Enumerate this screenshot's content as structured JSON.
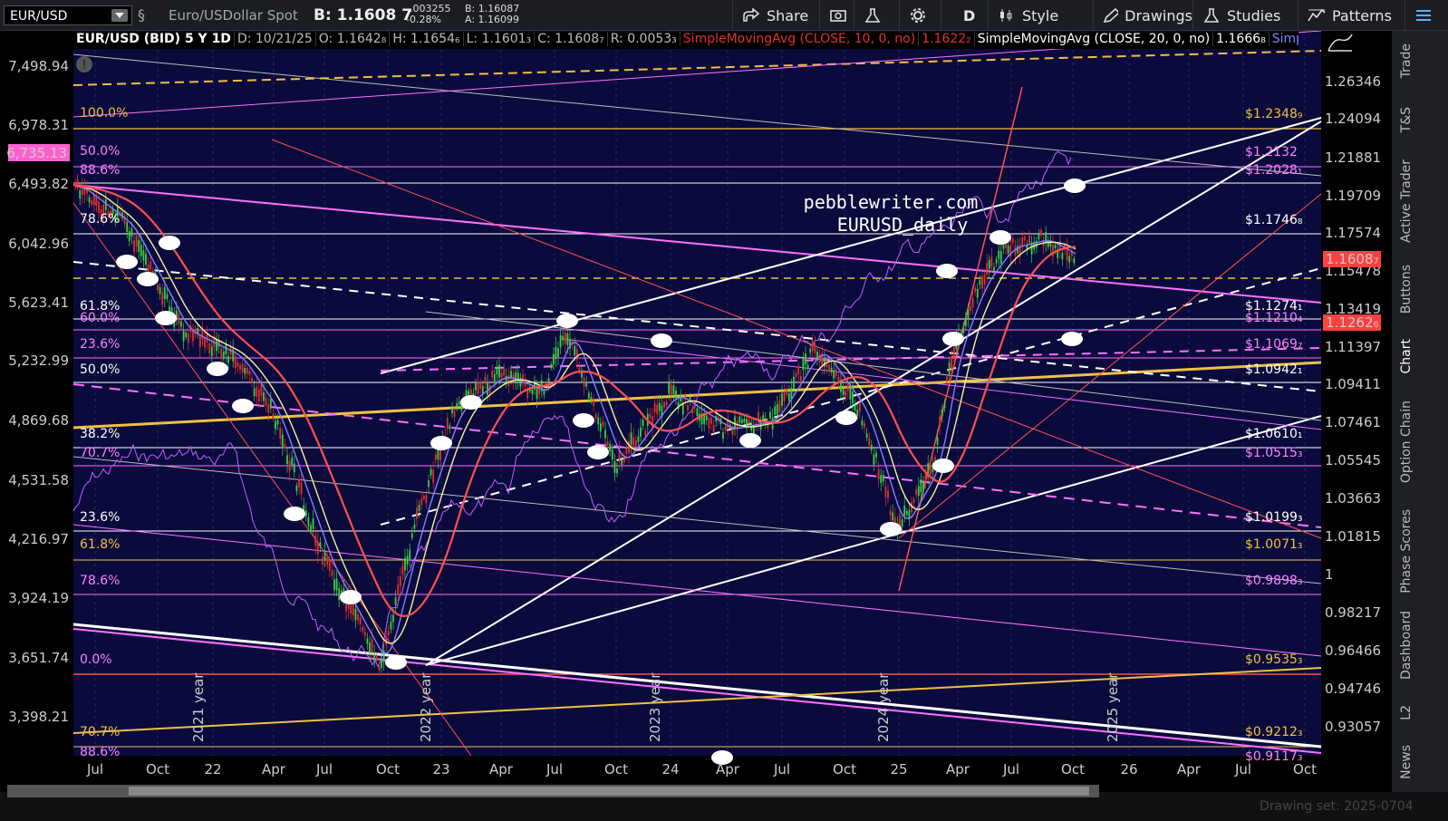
{
  "toolbar": {
    "symbol": "EUR/USD",
    "description": "Euro/USDollar Spot",
    "bid_price": "B: 1.1608 7",
    "net_change": "-.003255",
    "pct_change": "-0.28%",
    "bid_small": "B: 1.16087",
    "ask_small": "A: 1.16099",
    "buttons": [
      "Share",
      "D",
      "Style",
      "Drawings",
      "Studies",
      "Patterns"
    ]
  },
  "chart_header": {
    "symbol": "EUR/USD (BID) 5 Y 1D",
    "date": "D: 10/21/25",
    "open": "O: 1.1642₈",
    "high": "H: 1.1654₆",
    "low": "L: 1.1601₃",
    "close": "C: 1.1608₇",
    "range": "R: 0.0053₃",
    "sma10_label": "SimpleMovingAvg (CLOSE, 10, 0, no)",
    "sma10_value": "1.1622₂",
    "sma20_label": "SimpleMovingAvg (CLOSE, 20, 0, no)",
    "sma20_value": "1.1666₈",
    "more": "Simple..."
  },
  "watermark": {
    "line1": "pebblewriter.com",
    "line2": "EURUSD_daily"
  },
  "left_axis": [
    "7,498.94",
    "6,978.31",
    "6,493.82",
    "6,042.96",
    "5,623.41",
    "5,232.99",
    "4,869.68",
    "4,531.58",
    "4,216.97",
    "3,924.19",
    "3,651.74",
    "3,398.21"
  ],
  "left_axis_highlight": "6,735.13",
  "right_axis": [
    "1.26346",
    "1.24094",
    "1.21881",
    "1.19709",
    "1.17574",
    "1.15478",
    "1.13419",
    "1.11397",
    "1.09411",
    "1.07461",
    "1.05545",
    "1.03663",
    "1.01815",
    "1",
    "0.98217",
    "0.96466",
    "0.94746",
    "0.93057"
  ],
  "price_marker": "1.1608₇",
  "sma_marker": "1.1262₆",
  "x_axis": [
    "Jul",
    "Oct",
    "22",
    "Apr",
    "Jul",
    "Oct",
    "23",
    "Apr",
    "Jul",
    "Oct",
    "24",
    "Apr",
    "Jul",
    "Oct",
    "25",
    "Apr",
    "Jul",
    "Oct",
    "26",
    "Apr",
    "Jul",
    "Oct"
  ],
  "year_labels": [
    "2021 year",
    "2022 year",
    "2023 year",
    "2024 year",
    "2025 year"
  ],
  "fib_left": [
    {
      "label": "100.0%",
      "color": "#f0c040"
    },
    {
      "label": "50.0%",
      "color": "#ff80ff"
    },
    {
      "label": "88.6%",
      "color": "#ff80ff"
    },
    {
      "label": "78.6%",
      "color": "#ffffff"
    },
    {
      "label": "61.8%",
      "color": "#ffffff"
    },
    {
      "label": "60.0%",
      "color": "#ff80ff"
    },
    {
      "label": "23.6%",
      "color": "#ff80ff"
    },
    {
      "label": "50.0%",
      "color": "#ffffff"
    },
    {
      "label": "38.2%",
      "color": "#ffffff"
    },
    {
      "label": "70.7%",
      "color": "#ff80ff"
    },
    {
      "label": "23.6%",
      "color": "#ffffff"
    },
    {
      "label": "61.8%",
      "color": "#f0c040"
    },
    {
      "label": "78.6%",
      "color": "#ff80ff"
    },
    {
      "label": "0.0%",
      "color": "#ff80ff"
    },
    {
      "label": "70.7%",
      "color": "#f0c040"
    },
    {
      "label": "88.6%",
      "color": "#ff80ff"
    }
  ],
  "fib_right": [
    {
      "label": "$1.2348₉",
      "color": "#f0c040"
    },
    {
      "label": "$1.2132",
      "color": "#ff80ff"
    },
    {
      "label": "$1.2028₁",
      "color": "#ff80ff"
    },
    {
      "label": "$1.1746₈",
      "color": "#ffffff"
    },
    {
      "label": "$1.1274₁",
      "color": "#ffffff"
    },
    {
      "label": "$1.1210₄",
      "color": "#ff80ff"
    },
    {
      "label": "$1.1069₇",
      "color": "#ff80ff"
    },
    {
      "label": "$1.0942₁",
      "color": "#ffffff"
    },
    {
      "label": "$1.0610₁",
      "color": "#ffffff"
    },
    {
      "label": "$1.0515₃",
      "color": "#ff80ff"
    },
    {
      "label": "$1.0199₃",
      "color": "#ffffff"
    },
    {
      "label": "$1.0071₃",
      "color": "#f0c040"
    },
    {
      "label": "$0.9898₃",
      "color": "#ff80ff"
    },
    {
      "label": "$0.9535₃",
      "color": "#f0c040"
    },
    {
      "label": "$0.9212₃",
      "color": "#f0c040"
    },
    {
      "label": "$0.9117₃",
      "color": "#ff80ff"
    }
  ],
  "side_tabs": [
    "Trade",
    "T&S",
    "Active Trader",
    "Buttons",
    "Chart",
    "Option Chain",
    "Phase Scores",
    "Dashboard",
    "L2",
    "News"
  ],
  "drawing_set": "Drawing set: 2025-0704",
  "colors": {
    "chart_bg": "#0a0a3c",
    "pink": "#ff70ff",
    "gold": "#f0c040",
    "red_ma": "#ff5050",
    "blue_ma": "#8080ff",
    "yellow_ma": "#f5f0a0"
  }
}
